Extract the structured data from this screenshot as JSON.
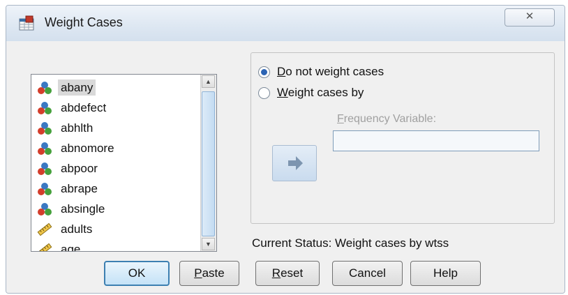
{
  "window": {
    "title": "Weight Cases",
    "close_glyph": "✕"
  },
  "variables": [
    {
      "name": "abany",
      "type": "nominal",
      "selected": true
    },
    {
      "name": "abdefect",
      "type": "nominal"
    },
    {
      "name": "abhlth",
      "type": "nominal"
    },
    {
      "name": "abnomore",
      "type": "nominal"
    },
    {
      "name": "abpoor",
      "type": "nominal"
    },
    {
      "name": "abrape",
      "type": "nominal"
    },
    {
      "name": "absingle",
      "type": "nominal"
    },
    {
      "name": "adults",
      "type": "scale"
    },
    {
      "name": "age",
      "type": "scale"
    }
  ],
  "options": {
    "do_not_weight": {
      "mnemonic": "D",
      "rest": "o not weight cases",
      "checked": true
    },
    "weight_by": {
      "mnemonic": "W",
      "rest": "eight cases by",
      "checked": false
    },
    "frequency_label": {
      "mnemonic": "F",
      "rest": "requency Variable:"
    },
    "frequency_value": ""
  },
  "status": "Current Status: Weight cases by wtss",
  "buttons": {
    "ok": "OK",
    "paste": {
      "mnemonic": "P",
      "rest": "aste"
    },
    "reset": {
      "mnemonic": "R",
      "rest": "eset"
    },
    "cancel": "Cancel",
    "help": "Help"
  },
  "icons": {
    "nominal": "nominal-variable-icon",
    "scale": "scale-variable-icon",
    "title": "weight-cases-app-icon",
    "move": "move-arrow-icon"
  },
  "colors": {
    "accent": "#2c64b4",
    "title_bar": "#dde7f2",
    "default_button": "#3c7fb1"
  }
}
